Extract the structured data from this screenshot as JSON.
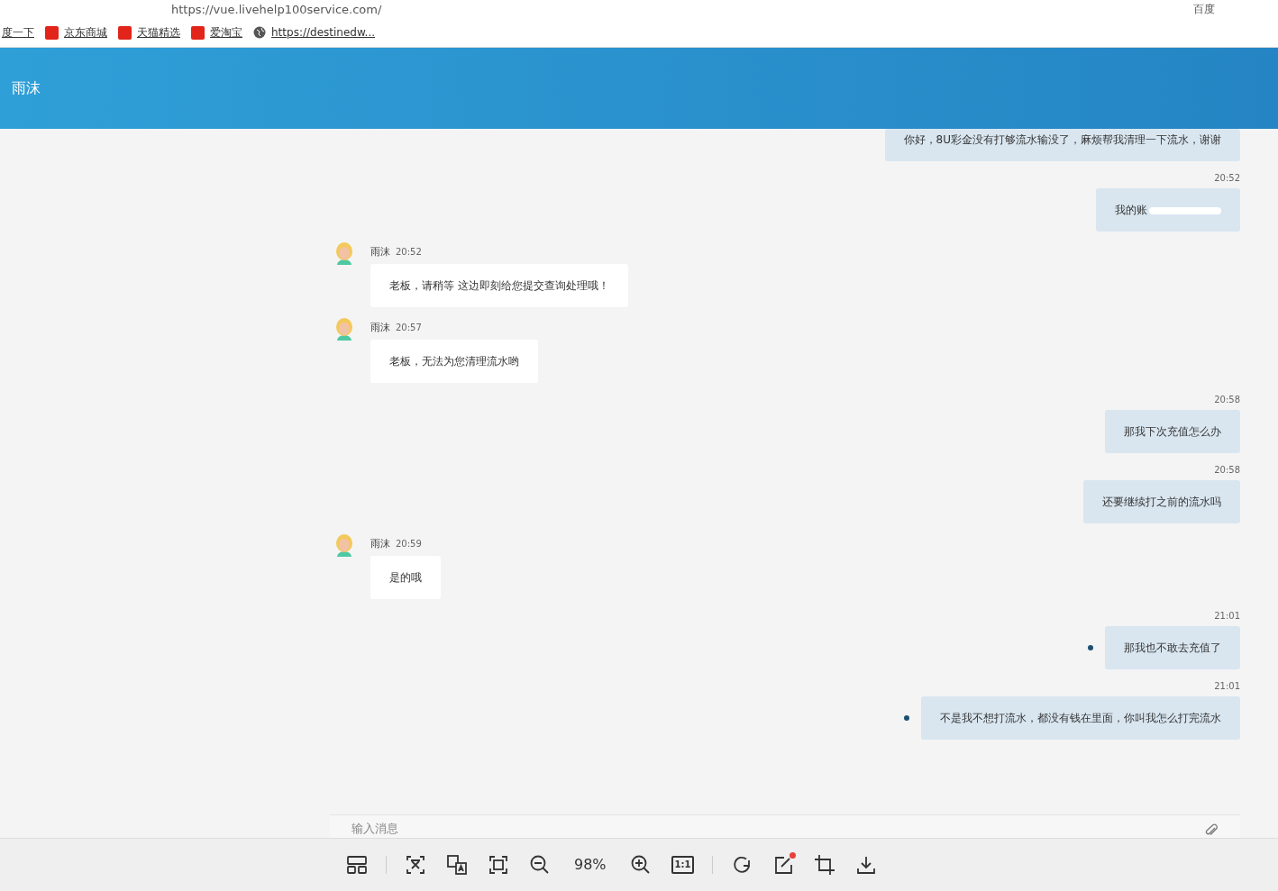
{
  "browser": {
    "url": "https://vue.livehelp100service.com/",
    "search_engine": "百度",
    "bookmarks": [
      {
        "kind": "baidu",
        "label": "度一下"
      },
      {
        "kind": "jd",
        "label": "京东商城"
      },
      {
        "kind": "tmall",
        "label": "天猫精选"
      },
      {
        "kind": "taobao",
        "label": "爱淘宝"
      },
      {
        "kind": "globe",
        "label": "https://destinedw..."
      }
    ]
  },
  "header": {
    "title": "雨沫"
  },
  "messages": [
    {
      "kind": "user",
      "text": "你好，8U彩金没有打够流水输没了，麻烦帮我清理一下流水，谢谢",
      "unread": false,
      "redacted": false
    },
    {
      "kind": "user",
      "time": "20:52",
      "text": "我的账",
      "unread": false,
      "redacted": true
    },
    {
      "kind": "agent",
      "name": "雨沫",
      "time": "20:52",
      "text": "老板，请稍等 这边即刻给您提交查询处理哦！"
    },
    {
      "kind": "agent",
      "name": "雨沫",
      "time": "20:57",
      "text": "老板，无法为您清理流水哟"
    },
    {
      "kind": "user",
      "time": "20:58",
      "text": "那我下次充值怎么办",
      "unread": false,
      "redacted": false
    },
    {
      "kind": "user",
      "time": "20:58",
      "text": "还要继续打之前的流水吗",
      "unread": false,
      "redacted": false
    },
    {
      "kind": "agent",
      "name": "雨沫",
      "time": "20:59",
      "text": "是的哦"
    },
    {
      "kind": "user",
      "time": "21:01",
      "text": "那我也不敢去充值了",
      "unread": true,
      "redacted": false
    },
    {
      "kind": "user",
      "time": "21:01",
      "text": "不是我不想打流水，都没有钱在里面，你叫我怎么打完流水",
      "unread": true,
      "redacted": false
    }
  ],
  "input": {
    "placeholder": "输入消息"
  },
  "viewer_toolbar": {
    "zoom": "98%",
    "actual_size_label": "1:1",
    "edit_notification": true
  }
}
